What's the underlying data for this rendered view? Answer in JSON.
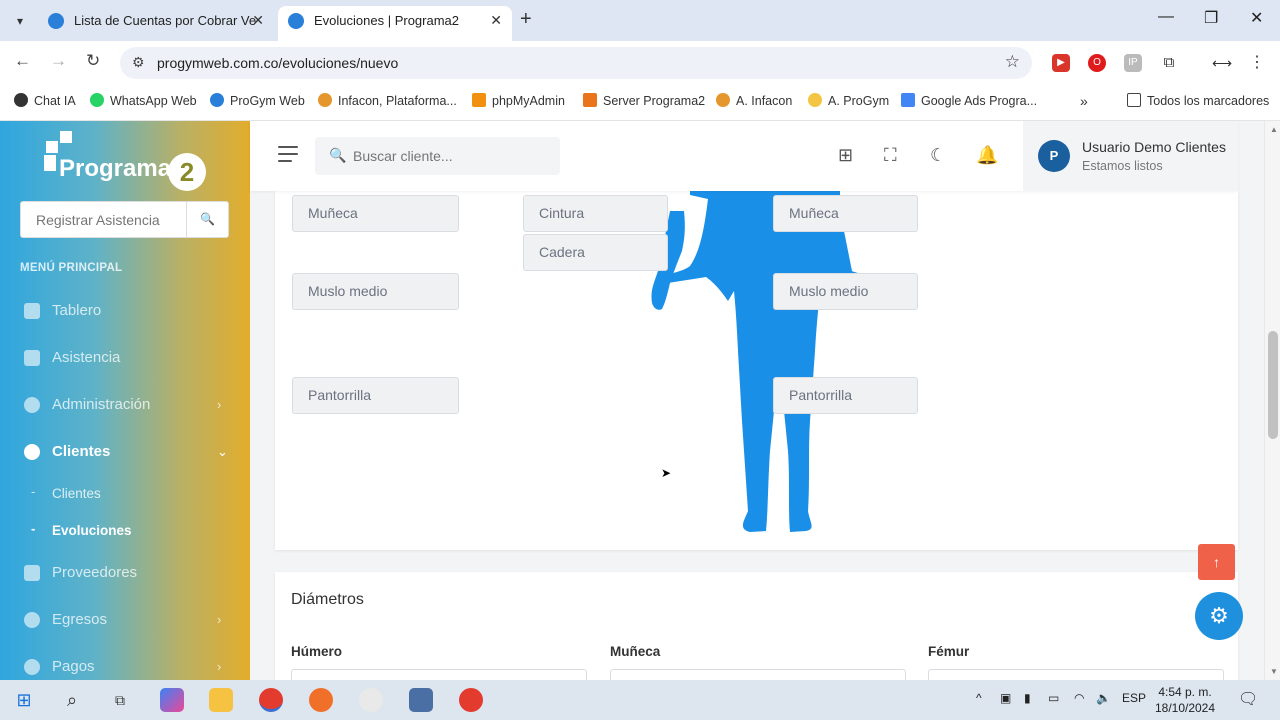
{
  "browser": {
    "tabs": [
      {
        "title": "Lista de Cuentas por Cobrar Ve"
      },
      {
        "title": "Evoluciones | Programa2"
      }
    ],
    "url": "progymweb.com.co/evoluciones/nuevo",
    "bookmarks": [
      "Chat IA",
      "WhatsApp Web",
      "ProGym Web",
      "Infacon, Plataforma...",
      "phpMyAdmin",
      "Server Programa2",
      "A. Infacon",
      "A. ProGym",
      "Google Ads Progra..."
    ],
    "all_bookmarks": "Todos los marcadores"
  },
  "sidebar": {
    "brand": "Programa",
    "brand_num": "2",
    "search_placeholder": "Registrar Asistencia",
    "section": "MENÚ PRINCIPAL",
    "items": [
      {
        "label": "Tablero"
      },
      {
        "label": "Asistencia"
      },
      {
        "label": "Administración"
      },
      {
        "label": "Clientes"
      },
      {
        "label": "Proveedores"
      },
      {
        "label": "Egresos"
      },
      {
        "label": "Pagos"
      }
    ],
    "subitems": [
      {
        "label": "Clientes"
      },
      {
        "label": "Evoluciones"
      }
    ]
  },
  "topbar": {
    "search_placeholder": "Buscar cliente...",
    "user_name": "Usuario Demo Clientes",
    "user_status": "Estamos listos"
  },
  "body_fields": {
    "left": [
      "Muñeca",
      "Muslo medio",
      "Pantorrilla"
    ],
    "center": [
      "Cintura",
      "Cadera"
    ],
    "right": [
      "Muñeca",
      "Muslo medio",
      "Pantorrilla"
    ]
  },
  "diametros": {
    "title": "Diámetros",
    "fields": [
      "Húmero",
      "Muñeca",
      "Fémur"
    ]
  },
  "taskbar": {
    "lang": "ESP",
    "time": "4:54 p. m.",
    "date": "18/10/2024"
  },
  "colors": {
    "body_figure": "#1a8fe8",
    "scroll_top_button": "#f0614a",
    "settings_button": "#1e90dd"
  }
}
